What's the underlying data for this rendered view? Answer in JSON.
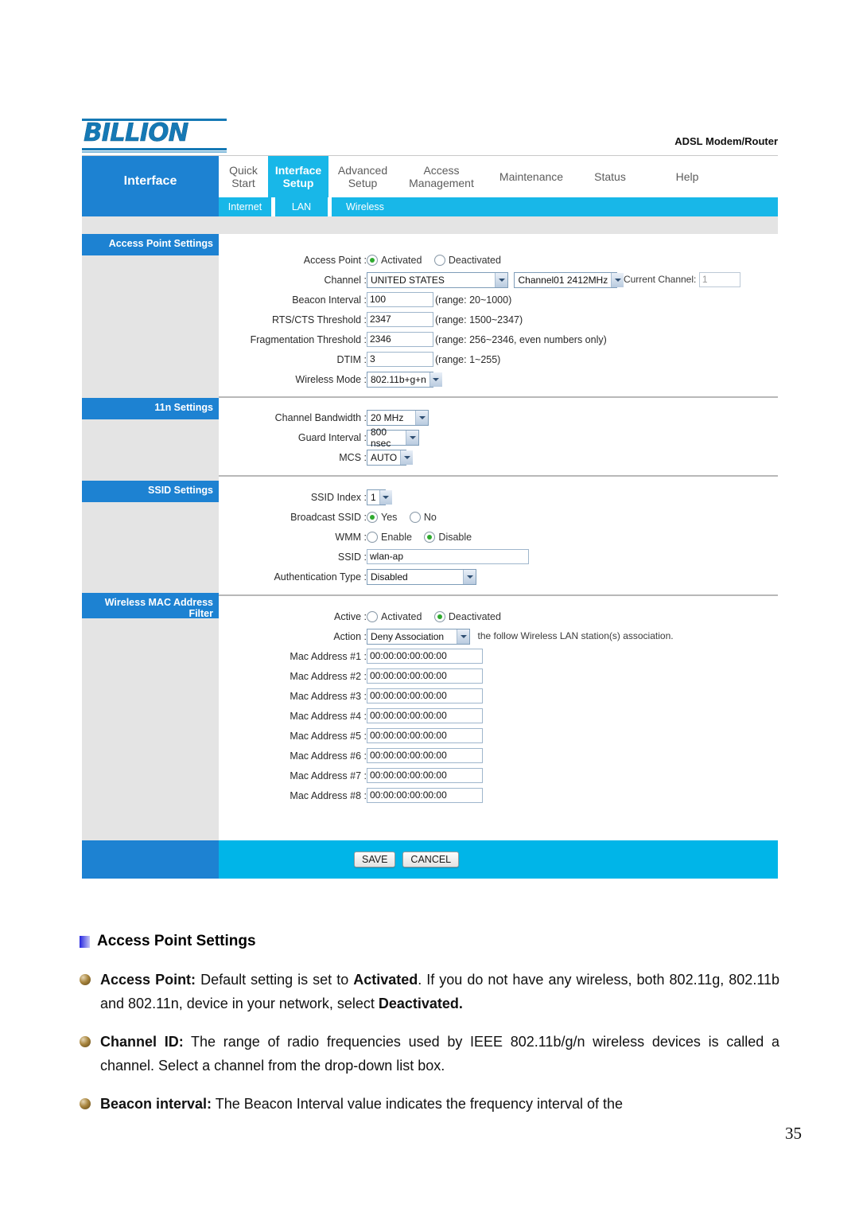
{
  "device": {
    "brand": "BILLION",
    "model_label": "ADSL Modem/Router",
    "section_title": "Interface"
  },
  "nav": {
    "tabs": [
      {
        "label": "Quick\nStart",
        "active": false
      },
      {
        "label": "Interface\nSetup",
        "active": true
      },
      {
        "label": "Advanced\nSetup",
        "active": false
      },
      {
        "label": "Access\nManagement",
        "active": false
      },
      {
        "label": "Maintenance",
        "active": false
      },
      {
        "label": "Status",
        "active": false
      },
      {
        "label": "Help",
        "active": false
      }
    ],
    "subtabs": [
      {
        "label": "Internet",
        "active": false
      },
      {
        "label": "LAN",
        "active": false
      },
      {
        "label": "Wireless",
        "active": true
      }
    ]
  },
  "sidebar": {
    "headers": [
      "Access Point Settings",
      "11n Settings",
      "SSID Settings",
      "Wireless MAC Address Filter"
    ]
  },
  "access_point": {
    "access_point_label": "Access Point :",
    "radio_activated": "Activated",
    "radio_deactivated": "Deactivated",
    "channel_label": "Channel :",
    "country_value": "UNITED STATES",
    "channel_value": "Channel01 2412MHz",
    "current_channel_label": "Current Channel:",
    "current_channel_value": "1",
    "beacon_label": "Beacon Interval :",
    "beacon_value": "100",
    "beacon_note": "(range: 20~1000)",
    "rts_label": "RTS/CTS Threshold :",
    "rts_value": "2347",
    "rts_note": "(range: 1500~2347)",
    "frag_label": "Fragmentation Threshold :",
    "frag_value": "2346",
    "frag_note": "(range: 256~2346, even numbers only)",
    "dtim_label": "DTIM :",
    "dtim_value": "3",
    "dtim_note": "(range: 1~255)",
    "wireless_mode_label": "Wireless Mode :",
    "wireless_mode_value": "802.11b+g+n"
  },
  "n11": {
    "bandwidth_label": "Channel Bandwidth :",
    "bandwidth_value": "20 MHz",
    "guard_label": "Guard Interval :",
    "guard_value": "800 nsec",
    "mcs_label": "MCS :",
    "mcs_value": "AUTO"
  },
  "ssid": {
    "index_label": "SSID Index :",
    "index_value": "1",
    "broadcast_label": "Broadcast SSID :",
    "broadcast_yes": "Yes",
    "broadcast_no": "No",
    "wmm_label": "WMM :",
    "wmm_enable": "Enable",
    "wmm_disable": "Disable",
    "ssid_label": "SSID :",
    "ssid_value": "wlan-ap",
    "auth_label": "Authentication Type :",
    "auth_value": "Disabled"
  },
  "mac_filter": {
    "active_label": "Active :",
    "active_activated": "Activated",
    "active_deactivated": "Deactivated",
    "action_label": "Action :",
    "action_value": "Deny Association",
    "action_note": "the follow Wireless LAN station(s) association.",
    "rows": [
      {
        "label": "Mac Address #1 :",
        "value": "00:00:00:00:00:00"
      },
      {
        "label": "Mac Address #2 :",
        "value": "00:00:00:00:00:00"
      },
      {
        "label": "Mac Address #3 :",
        "value": "00:00:00:00:00:00"
      },
      {
        "label": "Mac Address #4 :",
        "value": "00:00:00:00:00:00"
      },
      {
        "label": "Mac Address #5 :",
        "value": "00:00:00:00:00:00"
      },
      {
        "label": "Mac Address #6 :",
        "value": "00:00:00:00:00:00"
      },
      {
        "label": "Mac Address #7 :",
        "value": "00:00:00:00:00:00"
      },
      {
        "label": "Mac Address #8 :",
        "value": "00:00:00:00:00:00"
      }
    ]
  },
  "actions": {
    "save_label": "SAVE",
    "cancel_label": "CANCEL"
  },
  "prose": {
    "heading": "Access Point Settings",
    "p1": {
      "b1": "Access Point:",
      "t1": " Default setting is set to ",
      "b2": "Activated",
      "t2": ".  If you do not have any wireless, both 802.11g, 802.11b and 802.11n, device in your network, select ",
      "b3": "Deactivated."
    },
    "p2": {
      "b1": "Channel ID:",
      "t1": " The range of radio frequencies used by IEEE 802.11b/g/n wireless devices is called a channel. Select a channel from the drop-down list box."
    },
    "p3": {
      "b1": "Beacon interval:",
      "t1": " The Beacon Interval value indicates the frequency interval of the"
    }
  },
  "page_number": "35",
  "colors": {
    "brand_blue": "#1579b5",
    "nav_blue": "#1d82d2",
    "cyan": "#18b7e8",
    "bar_cyan": "#00b5e8",
    "gray": "#e4e4e4"
  }
}
